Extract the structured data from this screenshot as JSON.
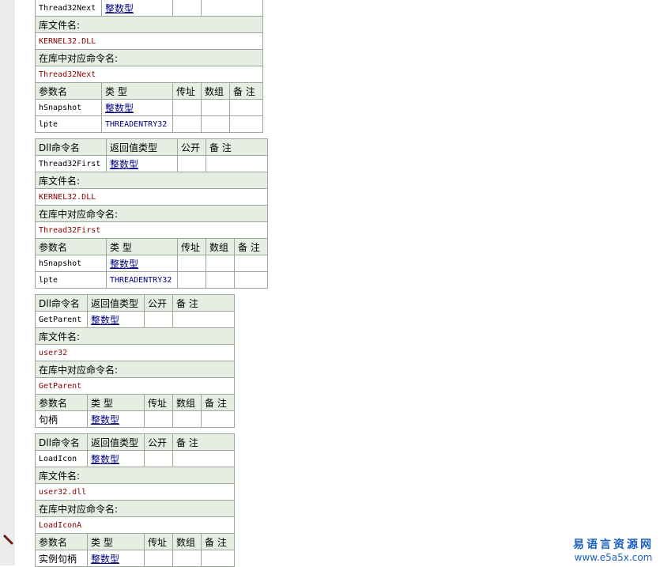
{
  "labels": {
    "dll_name": "Dll命令名",
    "return_type": "返回值类型",
    "public": "公开",
    "remark": "备 注",
    "lib_file": "库文件名:",
    "lib_cmd": "在库中对应命令名:",
    "param_name": "参数名",
    "type": "类 型",
    "by_ref": "传址",
    "array": "数组"
  },
  "blocks": [
    {
      "dll_name": "Thread32Next",
      "return_type": "整数型",
      "lib_file": "KERNEL32.DLL",
      "lib_cmd": "Thread32Next",
      "params": [
        {
          "name": "hSnapshot",
          "type": "整数型"
        },
        {
          "name": "lpte",
          "type": "THREADENTRY32"
        }
      ]
    },
    {
      "dll_name": "Thread32First",
      "return_type": "整数型",
      "lib_file": "KERNEL32.DLL",
      "lib_cmd": "Thread32First",
      "params": [
        {
          "name": "hSnapshot",
          "type": "整数型"
        },
        {
          "name": "lpte",
          "type": "THREADENTRY32"
        }
      ]
    },
    {
      "dll_name": "GetParent",
      "return_type": "整数型",
      "lib_file": "user32",
      "lib_cmd": "GetParent",
      "params": [
        {
          "name": "句柄",
          "type": "整数型"
        }
      ]
    },
    {
      "dll_name": "LoadIcon",
      "return_type": "整数型",
      "lib_file": "user32.dll",
      "lib_cmd": "LoadIconA",
      "params": [
        {
          "name": "实例句柄",
          "type": "整数型"
        }
      ]
    }
  ],
  "watermark": {
    "title": "易语言资源网",
    "url": "www.e5a5x.com"
  },
  "icons": {
    "edit": "pencil-icon"
  }
}
